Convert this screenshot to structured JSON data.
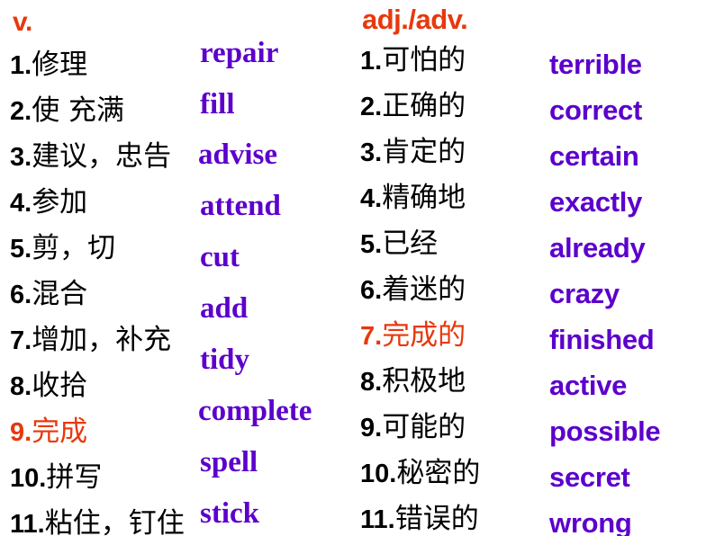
{
  "slide": {
    "background_color": "#ffffff",
    "accent_color": "#e8380d",
    "english_color": "#5c00cc",
    "chinese_color": "#000000"
  },
  "columns": [
    {
      "id": "verbs",
      "header": "v.",
      "rows": [
        {
          "num": "1.",
          "cn": "修理",
          "en": "repair",
          "highlight": false
        },
        {
          "num": "2.",
          "cn": "使  充满",
          "en": "fill",
          "highlight": false
        },
        {
          "num": "3.",
          "cn": "建议，忠告",
          "en": "advise",
          "highlight": false
        },
        {
          "num": "4.",
          "cn": "参加",
          "en": "attend",
          "highlight": false
        },
        {
          "num": "5.",
          "cn": "剪，切",
          "en": "cut",
          "highlight": false
        },
        {
          "num": "6.",
          "cn": "混合",
          "en": "add",
          "highlight": false
        },
        {
          "num": "7.",
          "cn": "增加，补充",
          "en": "tidy",
          "highlight": false
        },
        {
          "num": "8.",
          "cn": "收拾",
          "en": "complete",
          "highlight": false
        },
        {
          "num": "9.",
          "cn": "完成",
          "en": "spell",
          "highlight": true
        },
        {
          "num": "10.",
          "cn": "拼写",
          "en": "stick",
          "highlight": false
        },
        {
          "num": "11.",
          "cn": "粘住，钉住",
          "en": "",
          "highlight": false
        }
      ]
    },
    {
      "id": "adjectives-adverbs",
      "header": "adj./adv.",
      "rows": [
        {
          "num": "1.",
          "cn": "可怕的",
          "en": "terrible",
          "highlight": false
        },
        {
          "num": "2.",
          "cn": "正确的",
          "en": "correct",
          "highlight": false
        },
        {
          "num": "3.",
          "cn": "肯定的",
          "en": "certain",
          "highlight": false
        },
        {
          "num": "4.",
          "cn": "精确地",
          "en": "exactly",
          "highlight": false
        },
        {
          "num": "5.",
          "cn": "已经",
          "en": "already",
          "highlight": false
        },
        {
          "num": "6.",
          "cn": "着迷的",
          "en": "crazy",
          "highlight": false
        },
        {
          "num": "7.",
          "cn": "完成的",
          "en": "finished",
          "highlight": true
        },
        {
          "num": "8.",
          "cn": "积极地",
          "en": "active",
          "highlight": false
        },
        {
          "num": "9.",
          "cn": "可能的",
          "en": "possible",
          "highlight": false
        },
        {
          "num": "10.",
          "cn": "秘密的",
          "en": "secret",
          "highlight": false
        },
        {
          "num": "11.",
          "cn": "错误的",
          "en": "wrong",
          "highlight": false
        }
      ]
    }
  ]
}
